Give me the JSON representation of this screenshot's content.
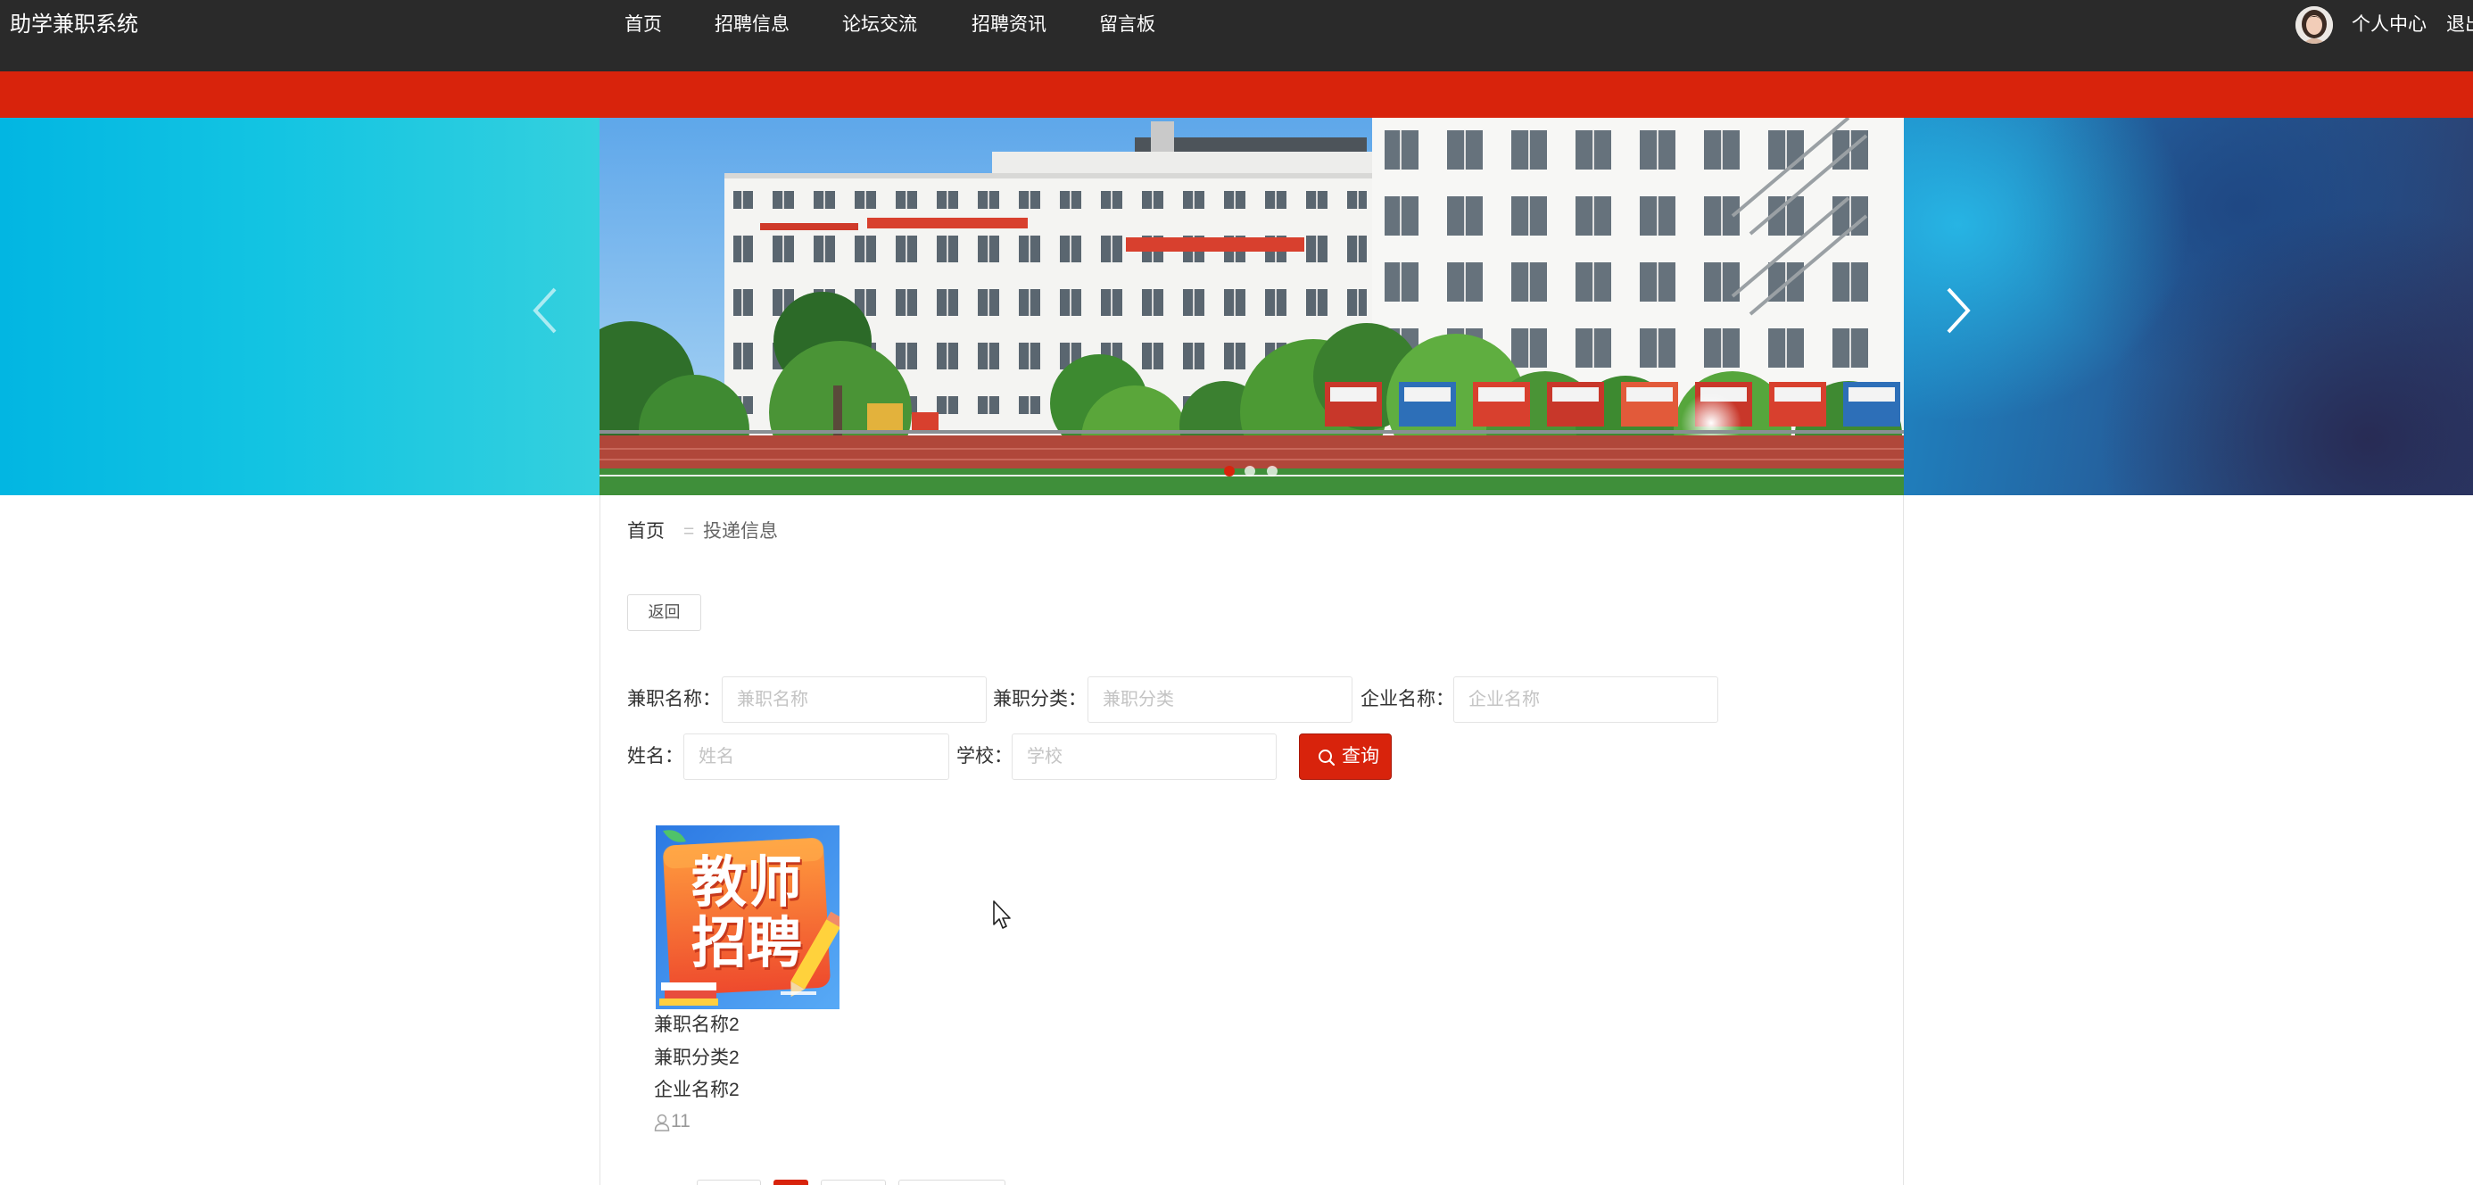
{
  "theme": {
    "header_bg": "#2a2a2a",
    "accent_red": "#d8230c"
  },
  "header": {
    "app_title": "助学兼职系统",
    "nav": [
      "首页",
      "招聘信息",
      "论坛交流",
      "招聘资讯",
      "留言板"
    ],
    "user_center": "个人中心",
    "logout": "退出"
  },
  "breadcrumb": {
    "home": "首页",
    "separator": "=",
    "current": "投递信息"
  },
  "back_label": "返回",
  "filters": [
    {
      "label": "兼职名称：",
      "placeholder": "兼职名称"
    },
    {
      "label": "兼职分类：",
      "placeholder": "兼职分类"
    },
    {
      "label": "企业名称：",
      "placeholder": "企业名称"
    },
    {
      "label": "姓名：",
      "placeholder": "姓名"
    },
    {
      "label": "学校：",
      "placeholder": "学校"
    }
  ],
  "search_button": "查询",
  "cards": [
    {
      "image_text": [
        "教师",
        "招聘"
      ],
      "name": "兼职名称2",
      "category": "兼职分类2",
      "company": "企业名称2",
      "count": "11"
    }
  ]
}
